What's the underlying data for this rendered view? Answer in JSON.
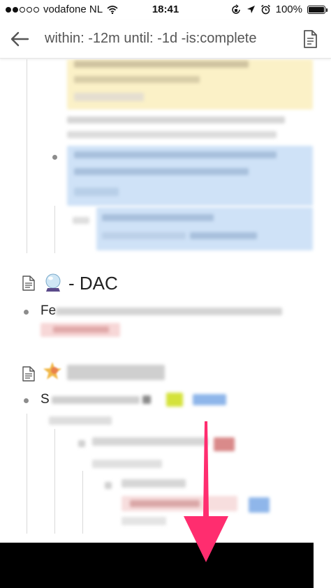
{
  "status_bar": {
    "carrier": "vodafone NL",
    "time": "18:41",
    "battery": "100%",
    "signal_dots_filled": 2,
    "signal_dots_total": 5
  },
  "toolbar": {
    "search_query": "within: -12m until: -1d -is:complete",
    "back_icon": "arrow-left-icon",
    "right_icon": "document-icon"
  },
  "content": {
    "section_dac": {
      "icon": "crystal-ball-icon",
      "title": "- DAC",
      "item_fragment": "Fe"
    },
    "section_second": {
      "icon": "star-icon",
      "item_fragment": "S"
    }
  },
  "overlay": {
    "arrow_color": "#ff2d6f",
    "direction": "down"
  },
  "colors": {
    "highlight_yellow": "#fbf1c7",
    "highlight_blue": "#cfe2f7",
    "tag_red": "#f7d7d7",
    "bullet": "#8c8c8c",
    "divider": "#e4e4e4"
  }
}
